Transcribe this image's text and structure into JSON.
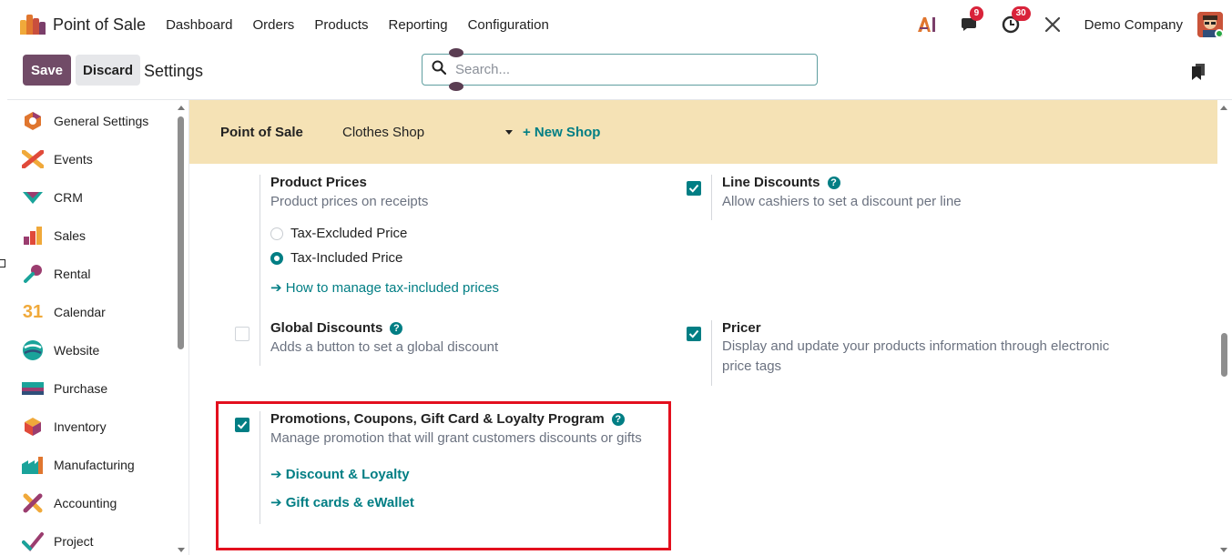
{
  "navbar": {
    "app_name": "Point of Sale",
    "menu": [
      "Dashboard",
      "Orders",
      "Products",
      "Reporting",
      "Configuration"
    ],
    "messages_count": "9",
    "activities_count": "30",
    "company": "Demo Company"
  },
  "control_panel": {
    "save_label": "Save",
    "discard_label": "Discard",
    "title": "Settings",
    "search_placeholder": "Search..."
  },
  "sidebar": {
    "items": [
      {
        "label": "General Settings",
        "icon": "general-settings-icon"
      },
      {
        "label": "Events",
        "icon": "events-icon"
      },
      {
        "label": "CRM",
        "icon": "crm-icon"
      },
      {
        "label": "Sales",
        "icon": "sales-icon"
      },
      {
        "label": "Rental",
        "icon": "rental-icon"
      },
      {
        "label": "Calendar",
        "icon": "calendar-icon"
      },
      {
        "label": "Website",
        "icon": "website-icon"
      },
      {
        "label": "Purchase",
        "icon": "purchase-icon"
      },
      {
        "label": "Inventory",
        "icon": "inventory-icon"
      },
      {
        "label": "Manufacturing",
        "icon": "manufacturing-icon"
      },
      {
        "label": "Accounting",
        "icon": "accounting-icon"
      },
      {
        "label": "Project",
        "icon": "project-icon"
      }
    ],
    "calendar_day": "31"
  },
  "shop_bar": {
    "label": "Point of Sale",
    "selected_shop": "Clothes Shop",
    "new_shop": "+ New Shop"
  },
  "settings": {
    "product_prices": {
      "title": "Product Prices",
      "desc": "Product prices on receipts",
      "options": [
        "Tax-Excluded Price",
        "Tax-Included Price"
      ],
      "selected": "Tax-Included Price",
      "link": "How to manage tax-included prices"
    },
    "line_discounts": {
      "title": "Line Discounts",
      "desc": "Allow cashiers to set a discount per line",
      "checked": true
    },
    "global_discounts": {
      "title": "Global Discounts",
      "desc": "Adds a button to set a global discount",
      "checked": false
    },
    "pricer": {
      "title": "Pricer",
      "desc": "Display and update your products information through electronic price tags",
      "checked": true
    },
    "promotions": {
      "title": "Promotions, Coupons, Gift Card & Loyalty Program",
      "desc": "Manage promotion that will grant customers discounts or gifts",
      "checked": true,
      "links": [
        "Discount & Loyalty",
        "Gift cards & eWallet"
      ]
    }
  },
  "colors": {
    "brand": "#714b67",
    "accent": "#017e84",
    "shop_bar_bg": "#f5e2b5",
    "highlight": "#e3101e"
  }
}
